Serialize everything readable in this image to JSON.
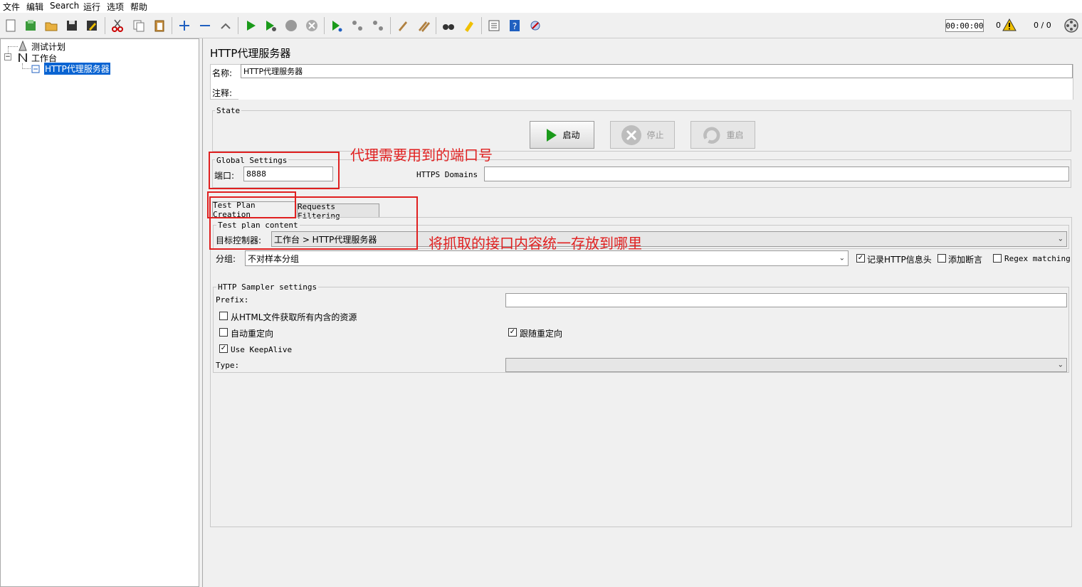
{
  "menu": [
    "文件",
    "编辑",
    "Search",
    "运行",
    "选项",
    "帮助"
  ],
  "toolbar": {
    "timer": "00:00:00",
    "warning_count": "0",
    "threads": "0 / 0"
  },
  "tree": {
    "items": [
      {
        "label": "测试计划"
      },
      {
        "label": "工作台"
      },
      {
        "label": "HTTP代理服务器"
      }
    ]
  },
  "panel": {
    "title": "HTTP代理服务器",
    "name_label": "名称:",
    "name_value": "HTTP代理服务器",
    "comment_label": "注释:",
    "comment_value": ""
  },
  "state": {
    "legend": "State",
    "start_label": "启动",
    "stop_label": "停止",
    "restart_label": "重启"
  },
  "global": {
    "legend": "Global Settings",
    "port_label": "端口:",
    "port_value": "8888",
    "https_label": "HTTPS Domains :",
    "https_value": ""
  },
  "tabs": [
    {
      "label": "Test Plan Creation"
    },
    {
      "label": "Requests Filtering"
    }
  ],
  "plan_content": {
    "legend": "Test plan content",
    "target_label": "目标控制器:",
    "target_value": "工作台 > HTTP代理服务器",
    "group_label": "分组:",
    "group_value": "不对样本分组",
    "record_headers": "记录HTTP信息头",
    "add_assertions": "添加断言",
    "regex_matching": "Regex matching"
  },
  "sampler": {
    "legend": "HTTP Sampler settings",
    "prefix_label": "Prefix:",
    "prefix_value": "",
    "retrieve_resources": "从HTML文件获取所有内含的资源",
    "auto_redirect": "自动重定向",
    "follow_redirects": "跟随重定向",
    "keepalive": "Use KeepAlive",
    "type_label": "Type:",
    "type_value": ""
  },
  "annotations": {
    "port_note": "代理需要用到的端口号",
    "target_note": "将抓取的接口内容统一存放到哪里"
  },
  "colors": {
    "annotation_red": "#e02020",
    "selection_blue": "#0a64d2",
    "start_green": "#1a9a1a"
  }
}
